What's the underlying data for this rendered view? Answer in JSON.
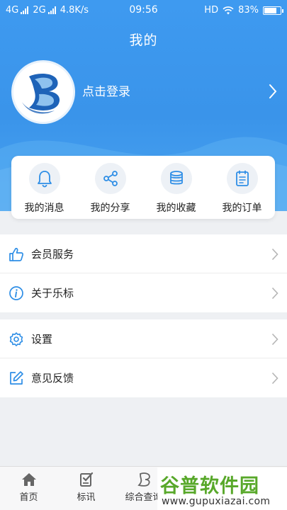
{
  "status_bar": {
    "network1": "4G",
    "network2": "2G",
    "speed": "4.8K/s",
    "time": "09:56",
    "hd": "HD",
    "battery": "83%",
    "battery_level": 0.83
  },
  "header": {
    "title": "我的"
  },
  "profile": {
    "login_label": "点击登录",
    "avatar_icon": "app-logo-b"
  },
  "quick_actions": [
    {
      "label": "我的消息",
      "icon": "bell-icon"
    },
    {
      "label": "我的分享",
      "icon": "share-icon"
    },
    {
      "label": "我的收藏",
      "icon": "coins-icon"
    },
    {
      "label": "我的订单",
      "icon": "clipboard-icon"
    }
  ],
  "menu_group_1": [
    {
      "label": "会员服务",
      "icon": "thumbs-up-icon"
    },
    {
      "label": "关于乐标",
      "icon": "info-icon"
    }
  ],
  "menu_group_2": [
    {
      "label": "设置",
      "icon": "gear-icon"
    },
    {
      "label": "意见反馈",
      "icon": "edit-icon"
    }
  ],
  "tabbar": [
    {
      "label": "首页",
      "icon": "home-icon"
    },
    {
      "label": "标讯",
      "icon": "notice-icon"
    },
    {
      "label": "综合查询",
      "icon": "search-logo-icon"
    }
  ],
  "watermark": {
    "title": "谷普软件园",
    "url": "www.gupuxiazai.com"
  },
  "colors": {
    "primary": "#3a94ea",
    "icon_blue": "#2e8ee6",
    "watermark_green": "#58a82a"
  }
}
